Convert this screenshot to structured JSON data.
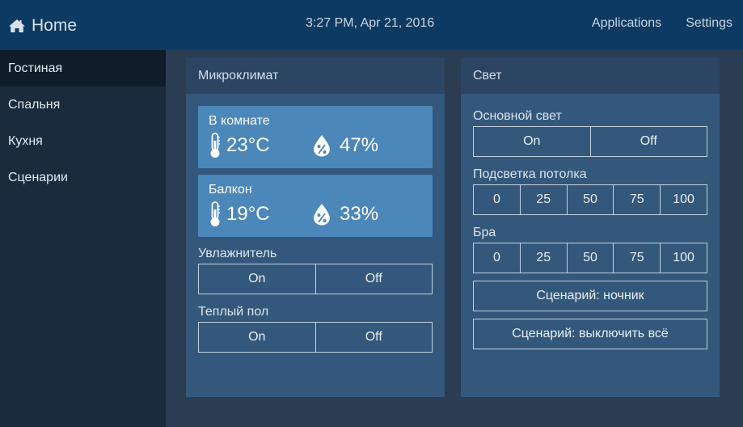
{
  "header": {
    "home_label": "Home",
    "datetime": "3:27 PM, Apr 21, 2016",
    "nav": [
      "Applications",
      "Settings"
    ]
  },
  "sidebar": {
    "items": [
      {
        "label": "Гостиная",
        "active": true
      },
      {
        "label": "Спальня"
      },
      {
        "label": "Кухня"
      },
      {
        "label": "Сценарии"
      }
    ]
  },
  "climate": {
    "title": "Микроклимат",
    "sensors": [
      {
        "name": "В комнате",
        "temperature": "23°C",
        "humidity": "47%"
      },
      {
        "name": "Балкон",
        "temperature": "19°C",
        "humidity": "33%"
      }
    ],
    "humidifier": {
      "label": "Увлажнитель",
      "on": "On",
      "off": "Off"
    },
    "floor": {
      "label": "Теплый пол",
      "on": "On",
      "off": "Off"
    }
  },
  "light": {
    "title": "Свет",
    "main": {
      "label": "Основной свет",
      "on": "On",
      "off": "Off"
    },
    "ceiling": {
      "label": "Подсветка потолка",
      "levels": [
        "0",
        "25",
        "50",
        "75",
        "100"
      ]
    },
    "sconce": {
      "label": "Бра",
      "levels": [
        "0",
        "25",
        "50",
        "75",
        "100"
      ]
    },
    "scenes": [
      "Сценарий: ночник",
      "Сценарий: выключить всё"
    ]
  },
  "colors": {
    "topbar": "#0d3a63",
    "sidebar": "#1b2b3e",
    "panel": "#34587c",
    "sensor_card": "#4c87ba"
  }
}
